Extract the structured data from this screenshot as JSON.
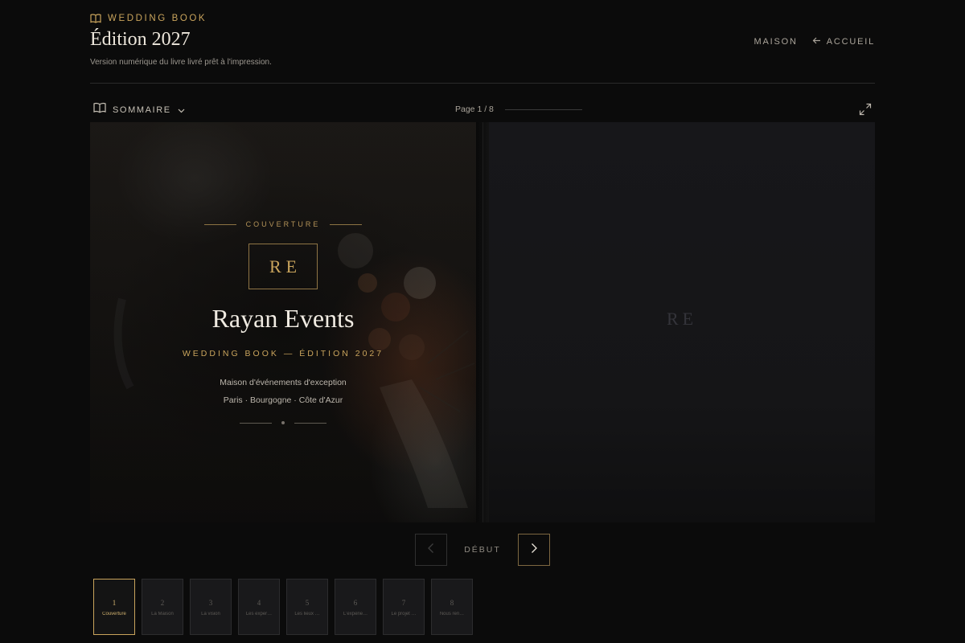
{
  "header": {
    "brand_label": "WEDDING BOOK",
    "title": "Édition 2027",
    "subtitle": "Version numérique du livre livré prêt à l'impression.",
    "nav": {
      "maison": "MAISON",
      "accueil": "ACCUEIL"
    }
  },
  "toolbar": {
    "summary_label": "SOMMAIRE",
    "page_indicator": "Page 1 / 8",
    "progress": 0.125
  },
  "cover": {
    "label": "COUVERTURE",
    "monogram": "RE",
    "title": "Rayan Events",
    "subtitle": "WEDDING BOOK — ÉDITION 2027",
    "line1": "Maison d'événements d'exception",
    "line2": "Paris · Bourgogne · Côte d'Azur"
  },
  "right_page": {
    "monogram": "RE"
  },
  "pager": {
    "label": "DÉBUT"
  },
  "thumbnails": [
    {
      "num": "1",
      "label": "Couverture",
      "active": true
    },
    {
      "num": "2",
      "label": "La Maison",
      "active": false
    },
    {
      "num": "3",
      "label": "La vision",
      "active": false
    },
    {
      "num": "4",
      "label": "Les exper…",
      "active": false
    },
    {
      "num": "5",
      "label": "Les lieux …",
      "active": false
    },
    {
      "num": "6",
      "label": "L'experie…",
      "active": false
    },
    {
      "num": "7",
      "label": "Le projet …",
      "active": false
    },
    {
      "num": "8",
      "label": "Nous ren…",
      "active": false
    }
  ],
  "colors": {
    "accent_gold": "#c9a45c",
    "background": "#0b0b0b",
    "page_dark": "#151517"
  }
}
